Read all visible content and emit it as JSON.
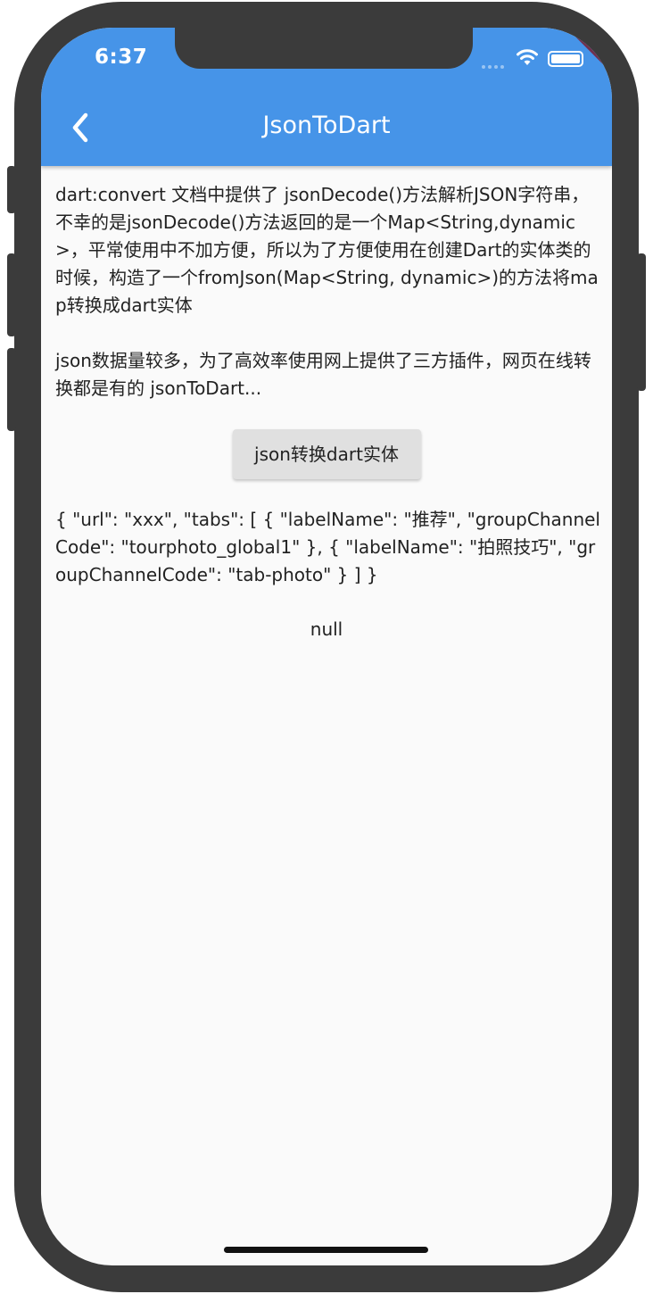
{
  "status_bar": {
    "time": "6:37",
    "icons": [
      "signal-dots-icon",
      "wifi-icon",
      "battery-icon"
    ],
    "debug_banner": "DEBUG"
  },
  "appbar": {
    "title": "JsonToDart",
    "back_icon": "chevron-left-icon",
    "color": "#4694e8"
  },
  "content": {
    "paragraph1": "dart:convert 文档中提供了 jsonDecode()方法解析JSON字符串，不幸的是jsonDecode()方法返回的是一个Map<String,dynamic>，平常使用中不加方便，所以为了方便使用在创建Dart的实体类的时候，构造了一个fromJson(Map<String, dynamic>)的方法将map转换成dart实体",
    "paragraph2": "json数据量较多，为了高效率使用网上提供了三方插件，网页在线转换都是有的 jsonToDart...",
    "convert_button_label": "json转换dart实体",
    "json_string": "{ \"url\": \"xxx\", \"tabs\": [ { \"labelName\": \"推荐\", \"groupChannelCode\": \"tourphoto_global1\" }, { \"labelName\": \"拍照技巧\", \"groupChannelCode\": \"tab-photo\" } ] }",
    "result": "null"
  }
}
